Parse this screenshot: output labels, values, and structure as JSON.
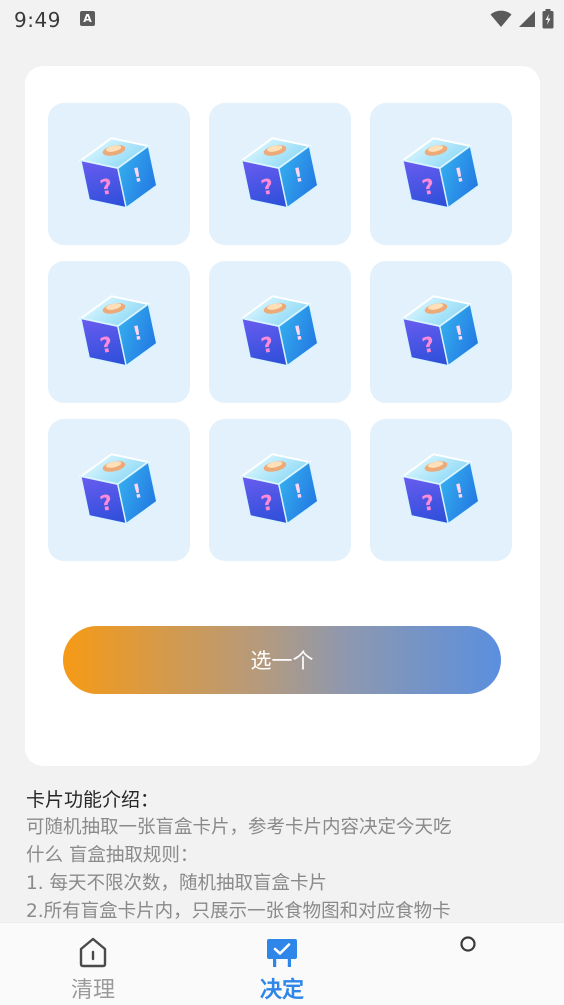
{
  "status_bar": {
    "time": "9:49",
    "notification_icon_text": "A",
    "icons": [
      "wifi-icon",
      "signal-icon",
      "battery-icon"
    ]
  },
  "card_grid": {
    "tiles": [
      {
        "icon": "mystery-box-icon"
      },
      {
        "icon": "mystery-box-icon"
      },
      {
        "icon": "mystery-box-icon"
      },
      {
        "icon": "mystery-box-icon"
      },
      {
        "icon": "mystery-box-icon"
      },
      {
        "icon": "mystery-box-icon"
      },
      {
        "icon": "mystery-box-icon"
      },
      {
        "icon": "mystery-box-icon"
      },
      {
        "icon": "mystery-box-icon"
      }
    ],
    "tile_color": "#e2f1fc"
  },
  "action": {
    "button_label": "选一个",
    "gradient_start": "#f69a16",
    "gradient_end": "#5b8fde"
  },
  "intro": {
    "title": "卡片功能介绍：",
    "lines": [
      "可随机抽取一张盲盒卡片，参考卡片内容决定今天吃",
      "什么 盲盒抽取规则：",
      "1. 每天不限次数，随机抽取盲盒卡片",
      "2.所有盲盒卡片内，只展示一张食物图和对应食物卡"
    ]
  },
  "bottom_nav": {
    "items": [
      {
        "label": "清理",
        "icon": "home-icon",
        "active": false
      },
      {
        "label": "决定",
        "icon": "decide-icon",
        "active": true
      },
      {
        "label": "",
        "icon": "profile-icon",
        "active": false
      }
    ],
    "active_color": "#2e86e8"
  }
}
